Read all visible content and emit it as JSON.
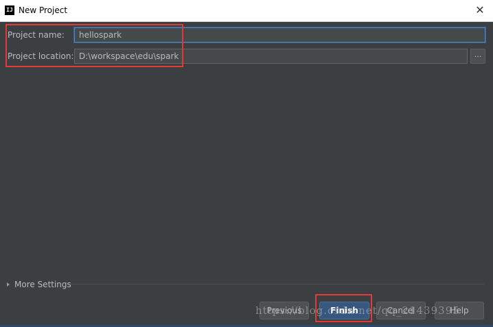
{
  "window": {
    "title": "New Project",
    "app_icon_text": "IJ",
    "close_symbol": "✕"
  },
  "form": {
    "project_name_label": "Project name:",
    "project_name_value": "hellospark",
    "project_location_label": "Project location:",
    "project_location_value": "D:\\workspace\\edu\\spark",
    "browse_label": "..."
  },
  "more_settings": {
    "label": "More Settings",
    "expanded": false
  },
  "buttons": {
    "previous": "Previous",
    "finish": "Finish",
    "cancel": "Cancel",
    "help": "Help"
  },
  "watermark": "https://blog.csdn.net/qq_21439395",
  "colors": {
    "background": "#3c3f41",
    "highlight_box": "#e53935",
    "primary_button": "#365880"
  }
}
